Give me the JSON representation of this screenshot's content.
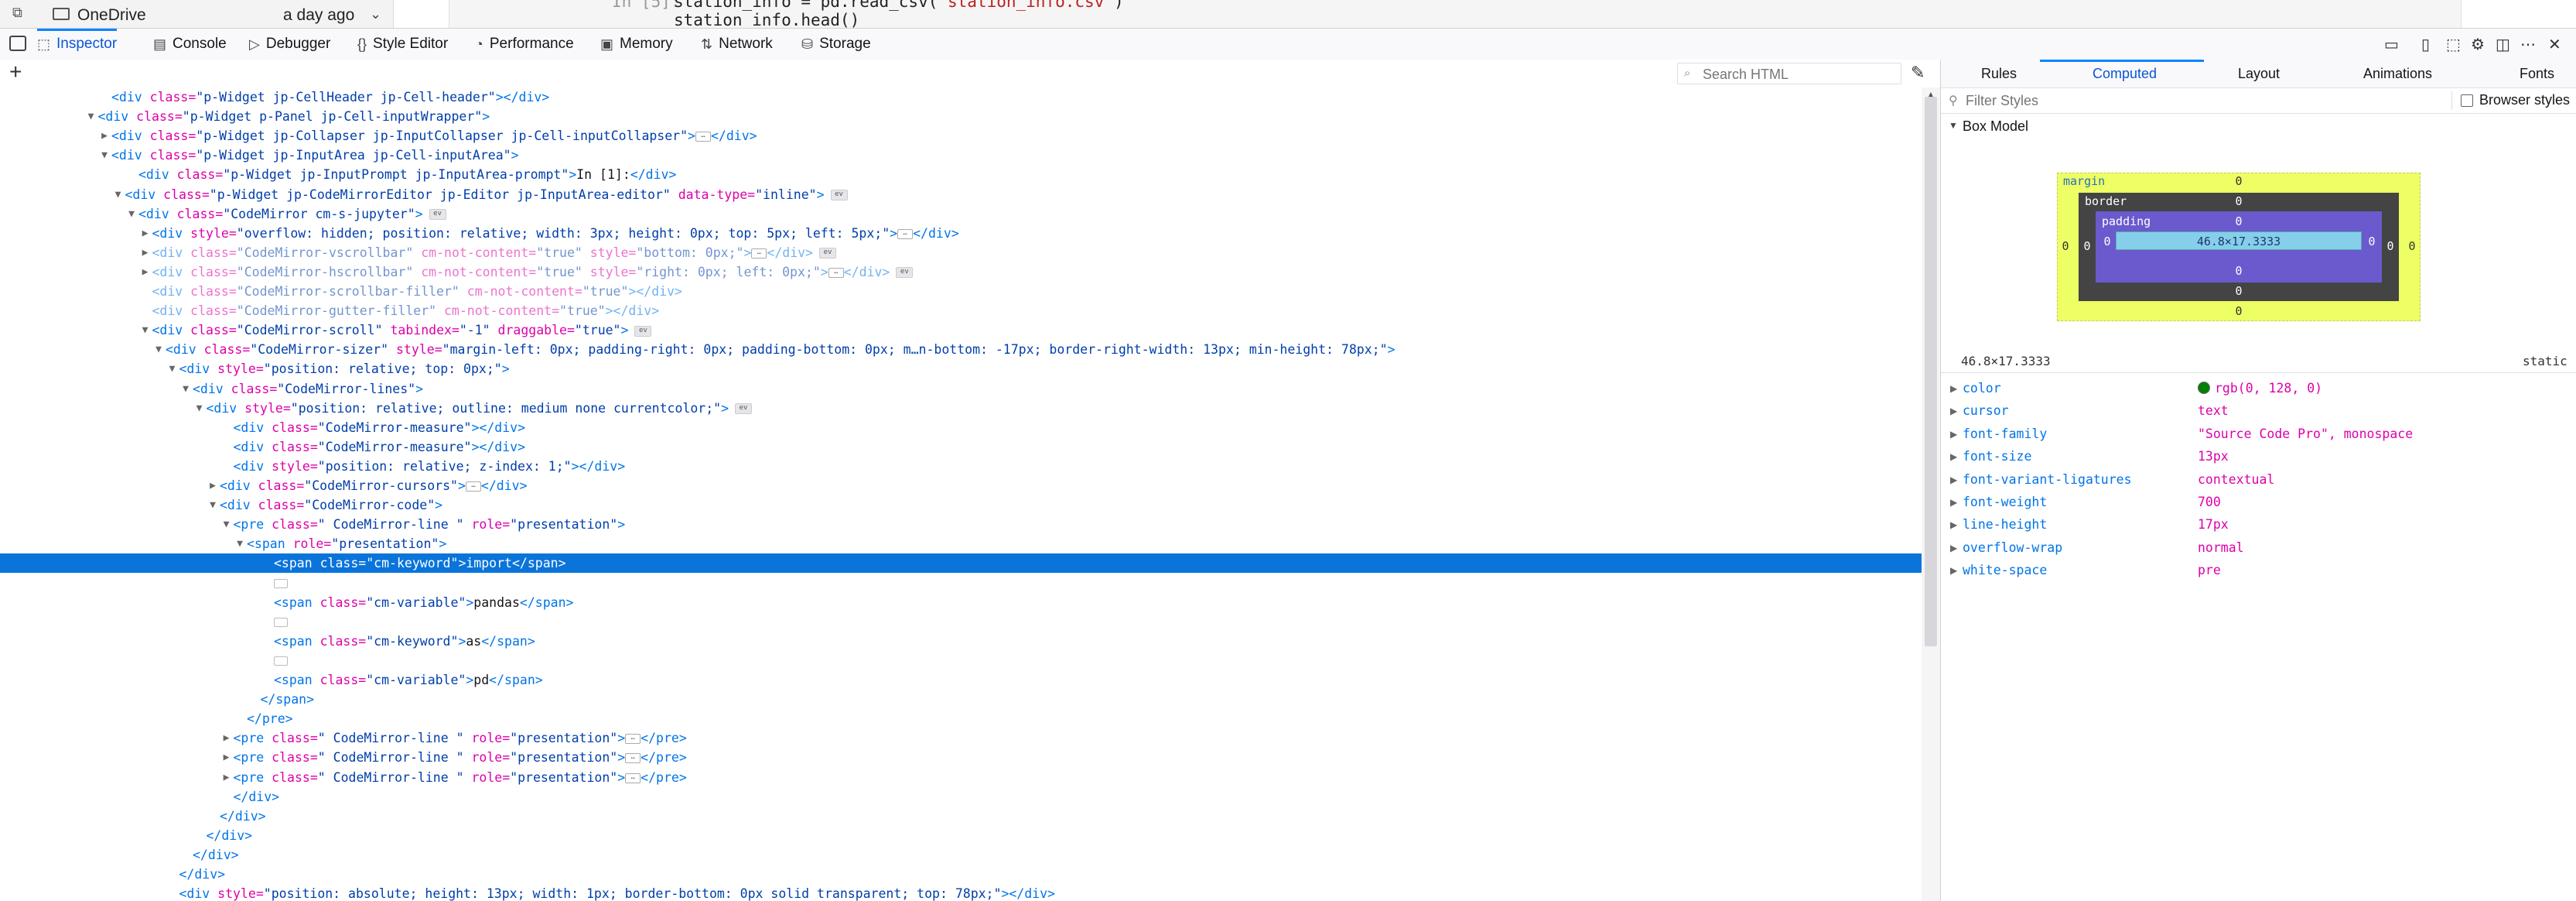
{
  "top_strip": {
    "file_item": "OneDrive",
    "file_modified": "a day ago",
    "prompt": "In [5]:",
    "code_line1_prefix": "station_info = pd.read_csv(",
    "code_line1_string": "'station_info.csv'",
    "code_line1_suffix": ")",
    "code_line2": "station_info.head()"
  },
  "toolbar": {
    "tabs": [
      {
        "label": "Inspector",
        "icon": "inspector-icon",
        "selected": true
      },
      {
        "label": "Console",
        "icon": "console-icon"
      },
      {
        "label": "Debugger",
        "icon": "debugger-icon"
      },
      {
        "label": "Style Editor",
        "icon": "style-editor-icon"
      },
      {
        "label": "Performance",
        "icon": "performance-icon"
      },
      {
        "label": "Memory",
        "icon": "memory-icon"
      },
      {
        "label": "Network",
        "icon": "network-icon"
      },
      {
        "label": "Storage",
        "icon": "storage-icon"
      }
    ]
  },
  "inspector": {
    "search_placeholder": "Search HTML",
    "tree": [
      {
        "depth": 8,
        "segs": [
          [
            "tg",
            "<div "
          ],
          [
            "at",
            "class="
          ],
          [
            "av",
            "\"p-Widget jp-CellHeader jp-Cell-header\""
          ],
          [
            "tg",
            "></div>"
          ]
        ]
      },
      {
        "depth": 7,
        "tw": "open",
        "segs": [
          [
            "tg",
            "<div "
          ],
          [
            "at",
            "class="
          ],
          [
            "av",
            "\"p-Widget p-Panel jp-Cell-inputWrapper\""
          ],
          [
            "tg",
            ">"
          ]
        ]
      },
      {
        "depth": 8,
        "tw": "closed",
        "segs": [
          [
            "tg",
            "<div "
          ],
          [
            "at",
            "class="
          ],
          [
            "av",
            "\"p-Widget jp-Collapser jp-InputCollapser jp-Cell-inputCollapser\""
          ],
          [
            "tg",
            ">"
          ],
          [
            "ell",
            ""
          ],
          [
            "tg",
            "</div>"
          ]
        ]
      },
      {
        "depth": 8,
        "tw": "open",
        "segs": [
          [
            "tg",
            "<div "
          ],
          [
            "at",
            "class="
          ],
          [
            "av",
            "\"p-Widget jp-InputArea jp-Cell-inputArea\""
          ],
          [
            "tg",
            ">"
          ]
        ]
      },
      {
        "depth": 10,
        "segs": [
          [
            "tg",
            "<div "
          ],
          [
            "at",
            "class="
          ],
          [
            "av",
            "\"p-Widget jp-InputPrompt jp-InputArea-prompt\""
          ],
          [
            "tg",
            ">"
          ],
          [
            "pl",
            "In [1]:"
          ],
          [
            "tg",
            "</div>"
          ]
        ]
      },
      {
        "depth": 9,
        "tw": "open",
        "segs": [
          [
            "tg",
            "<div "
          ],
          [
            "at",
            "class="
          ],
          [
            "av",
            "\"p-Widget jp-CodeMirrorEditor jp-Editor jp-InputArea-editor\" "
          ],
          [
            "at",
            "data-type="
          ],
          [
            "av",
            "\"inline\""
          ],
          [
            "tg",
            ">"
          ],
          [
            "badge",
            "ev"
          ]
        ]
      },
      {
        "depth": 10,
        "tw": "open",
        "segs": [
          [
            "tg",
            "<div "
          ],
          [
            "at",
            "class="
          ],
          [
            "av",
            "\"CodeMirror cm-s-jupyter\""
          ],
          [
            "tg",
            ">"
          ],
          [
            "badge",
            "ev"
          ]
        ]
      },
      {
        "depth": 11,
        "tw": "closed",
        "segs": [
          [
            "tg",
            "<div "
          ],
          [
            "at",
            "style="
          ],
          [
            "av",
            "\"overflow: hidden; position: relative; width: 3px; height: 0px; top: 5px; left: 5px;\""
          ],
          [
            "tg",
            ">"
          ],
          [
            "ell",
            ""
          ],
          [
            "tg",
            "</div>"
          ]
        ]
      },
      {
        "depth": 11,
        "tw": "closed",
        "dim": true,
        "segs": [
          [
            "tg",
            "<div "
          ],
          [
            "at",
            "class="
          ],
          [
            "av",
            "\"CodeMirror-vscrollbar\" "
          ],
          [
            "at",
            "cm-not-content="
          ],
          [
            "av",
            "\"true\" "
          ],
          [
            "at",
            "style="
          ],
          [
            "av",
            "\"bottom: 0px;\""
          ],
          [
            "tg",
            ">"
          ],
          [
            "ell",
            ""
          ],
          [
            "tg",
            "</div>"
          ],
          [
            "badge",
            "ev"
          ]
        ]
      },
      {
        "depth": 11,
        "tw": "closed",
        "dim": true,
        "segs": [
          [
            "tg",
            "<div "
          ],
          [
            "at",
            "class="
          ],
          [
            "av",
            "\"CodeMirror-hscrollbar\" "
          ],
          [
            "at",
            "cm-not-content="
          ],
          [
            "av",
            "\"true\" "
          ],
          [
            "at",
            "style="
          ],
          [
            "av",
            "\"right: 0px; left: 0px;\""
          ],
          [
            "tg",
            ">"
          ],
          [
            "ell",
            ""
          ],
          [
            "tg",
            "</div>"
          ],
          [
            "badge",
            "ev"
          ]
        ]
      },
      {
        "depth": 11,
        "dim": true,
        "segs": [
          [
            "tg",
            "<div "
          ],
          [
            "at",
            "class="
          ],
          [
            "av",
            "\"CodeMirror-scrollbar-filler\" "
          ],
          [
            "at",
            "cm-not-content="
          ],
          [
            "av",
            "\"true\""
          ],
          [
            "tg",
            "></div>"
          ]
        ]
      },
      {
        "depth": 11,
        "dim": true,
        "segs": [
          [
            "tg",
            "<div "
          ],
          [
            "at",
            "class="
          ],
          [
            "av",
            "\"CodeMirror-gutter-filler\" "
          ],
          [
            "at",
            "cm-not-content="
          ],
          [
            "av",
            "\"true\""
          ],
          [
            "tg",
            "></div>"
          ]
        ]
      },
      {
        "depth": 11,
        "tw": "open",
        "segs": [
          [
            "tg",
            "<div "
          ],
          [
            "at",
            "class="
          ],
          [
            "av",
            "\"CodeMirror-scroll\" "
          ],
          [
            "at",
            "tabindex="
          ],
          [
            "av",
            "\"-1\" "
          ],
          [
            "at",
            "draggable="
          ],
          [
            "av",
            "\"true\""
          ],
          [
            "tg",
            ">"
          ],
          [
            "badge",
            "ev"
          ]
        ]
      },
      {
        "depth": 12,
        "tw": "open",
        "segs": [
          [
            "tg",
            "<div "
          ],
          [
            "at",
            "class="
          ],
          [
            "av",
            "\"CodeMirror-sizer\" "
          ],
          [
            "at",
            "style="
          ],
          [
            "av",
            "\"margin-left: 0px; padding-right: 0px; padding-bottom: 0px; m…n-bottom: -17px; border-right-width: 13px; min-height: 78px;\""
          ],
          [
            "tg",
            ">"
          ]
        ]
      },
      {
        "depth": 13,
        "tw": "open",
        "segs": [
          [
            "tg",
            "<div "
          ],
          [
            "at",
            "style="
          ],
          [
            "av",
            "\"position: relative; top: 0px;\""
          ],
          [
            "tg",
            ">"
          ]
        ]
      },
      {
        "depth": 14,
        "tw": "open",
        "segs": [
          [
            "tg",
            "<div "
          ],
          [
            "at",
            "class="
          ],
          [
            "av",
            "\"CodeMirror-lines\""
          ],
          [
            "tg",
            ">"
          ]
        ]
      },
      {
        "depth": 15,
        "tw": "open",
        "segs": [
          [
            "tg",
            "<div "
          ],
          [
            "at",
            "style="
          ],
          [
            "av",
            "\"position: relative; outline: medium none currentcolor;\""
          ],
          [
            "tg",
            ">"
          ],
          [
            "badge",
            "ev"
          ]
        ]
      },
      {
        "depth": 17,
        "segs": [
          [
            "tg",
            "<div "
          ],
          [
            "at",
            "class="
          ],
          [
            "av",
            "\"CodeMirror-measure\""
          ],
          [
            "tg",
            "></div>"
          ]
        ]
      },
      {
        "depth": 17,
        "segs": [
          [
            "tg",
            "<div "
          ],
          [
            "at",
            "class="
          ],
          [
            "av",
            "\"CodeMirror-measure\""
          ],
          [
            "tg",
            "></div>"
          ]
        ]
      },
      {
        "depth": 17,
        "segs": [
          [
            "tg",
            "<div "
          ],
          [
            "at",
            "style="
          ],
          [
            "av",
            "\"position: relative; z-index: 1;\""
          ],
          [
            "tg",
            "></div>"
          ]
        ]
      },
      {
        "depth": 16,
        "tw": "closed",
        "segs": [
          [
            "tg",
            "<div "
          ],
          [
            "at",
            "class="
          ],
          [
            "av",
            "\"CodeMirror-cursors\""
          ],
          [
            "tg",
            ">"
          ],
          [
            "ell",
            ""
          ],
          [
            "tg",
            "</div>"
          ]
        ]
      },
      {
        "depth": 16,
        "tw": "open",
        "segs": [
          [
            "tg",
            "<div "
          ],
          [
            "at",
            "class="
          ],
          [
            "av",
            "\"CodeMirror-code\""
          ],
          [
            "tg",
            ">"
          ]
        ]
      },
      {
        "depth": 17,
        "tw": "open",
        "segs": [
          [
            "tg",
            "<pre "
          ],
          [
            "at",
            "class="
          ],
          [
            "av",
            "\" CodeMirror-line \" "
          ],
          [
            "at",
            "role="
          ],
          [
            "av",
            "\"presentation\""
          ],
          [
            "tg",
            ">"
          ]
        ]
      },
      {
        "depth": 18,
        "tw": "open",
        "segs": [
          [
            "tg",
            "<span "
          ],
          [
            "at",
            "role="
          ],
          [
            "av",
            "\"presentation\""
          ],
          [
            "tg",
            ">"
          ]
        ]
      },
      {
        "depth": 20,
        "selected": true,
        "segs": [
          [
            "tg",
            "<span "
          ],
          [
            "at",
            "class="
          ],
          [
            "av",
            "\"cm-keyword\""
          ],
          [
            "tg",
            ">"
          ],
          [
            "pl",
            "import"
          ],
          [
            "tg",
            "</span>"
          ]
        ]
      },
      {
        "depth": 20,
        "segs": [
          [
            "ws",
            ""
          ]
        ]
      },
      {
        "depth": 20,
        "segs": [
          [
            "tg",
            "<span "
          ],
          [
            "at",
            "class="
          ],
          [
            "av",
            "\"cm-variable\""
          ],
          [
            "tg",
            ">"
          ],
          [
            "pl",
            "pandas"
          ],
          [
            "tg",
            "</span>"
          ]
        ]
      },
      {
        "depth": 20,
        "segs": [
          [
            "ws",
            ""
          ]
        ]
      },
      {
        "depth": 20,
        "segs": [
          [
            "tg",
            "<span "
          ],
          [
            "at",
            "class="
          ],
          [
            "av",
            "\"cm-keyword\""
          ],
          [
            "tg",
            ">"
          ],
          [
            "pl",
            "as"
          ],
          [
            "tg",
            "</span>"
          ]
        ]
      },
      {
        "depth": 20,
        "segs": [
          [
            "ws",
            ""
          ]
        ]
      },
      {
        "depth": 20,
        "segs": [
          [
            "tg",
            "<span "
          ],
          [
            "at",
            "class="
          ],
          [
            "av",
            "\"cm-variable\""
          ],
          [
            "tg",
            ">"
          ],
          [
            "pl",
            "pd"
          ],
          [
            "tg",
            "</span>"
          ]
        ]
      },
      {
        "depth": 19,
        "segs": [
          [
            "tg",
            "</span>"
          ]
        ]
      },
      {
        "depth": 18,
        "segs": [
          [
            "tg",
            "</pre>"
          ]
        ]
      },
      {
        "depth": 17,
        "tw": "closed",
        "segs": [
          [
            "tg",
            "<pre "
          ],
          [
            "at",
            "class="
          ],
          [
            "av",
            "\" CodeMirror-line \" "
          ],
          [
            "at",
            "role="
          ],
          [
            "av",
            "\"presentation\""
          ],
          [
            "tg",
            ">"
          ],
          [
            "ell",
            ""
          ],
          [
            "tg",
            "</pre>"
          ]
        ]
      },
      {
        "depth": 17,
        "tw": "closed",
        "segs": [
          [
            "tg",
            "<pre "
          ],
          [
            "at",
            "class="
          ],
          [
            "av",
            "\" CodeMirror-line \" "
          ],
          [
            "at",
            "role="
          ],
          [
            "av",
            "\"presentation\""
          ],
          [
            "tg",
            ">"
          ],
          [
            "ell",
            ""
          ],
          [
            "tg",
            "</pre>"
          ]
        ]
      },
      {
        "depth": 17,
        "tw": "closed",
        "segs": [
          [
            "tg",
            "<pre "
          ],
          [
            "at",
            "class="
          ],
          [
            "av",
            "\" CodeMirror-line \" "
          ],
          [
            "at",
            "role="
          ],
          [
            "av",
            "\"presentation\""
          ],
          [
            "tg",
            ">"
          ],
          [
            "ell",
            ""
          ],
          [
            "tg",
            "</pre>"
          ]
        ]
      },
      {
        "depth": 17,
        "segs": [
          [
            "tg",
            "</div>"
          ]
        ]
      },
      {
        "depth": 16,
        "segs": [
          [
            "tg",
            "</div>"
          ]
        ]
      },
      {
        "depth": 15,
        "segs": [
          [
            "tg",
            "</div>"
          ]
        ]
      },
      {
        "depth": 14,
        "segs": [
          [
            "tg",
            "</div>"
          ]
        ]
      },
      {
        "depth": 13,
        "segs": [
          [
            "tg",
            "</div>"
          ]
        ]
      },
      {
        "depth": 13,
        "segs": [
          [
            "tg",
            "<div "
          ],
          [
            "at",
            "style="
          ],
          [
            "av",
            "\"position: absolute; height: 13px; width: 1px; border-bottom: 0px solid transparent; top: 78px;\""
          ],
          [
            "tg",
            "></div>"
          ]
        ]
      }
    ]
  },
  "sidebar": {
    "tabs": [
      "Rules",
      "Computed",
      "Layout",
      "Animations",
      "Fonts"
    ],
    "selected_tab": "Computed",
    "filter_placeholder": "Filter Styles",
    "browser_styles_label": "Browser styles",
    "browser_styles_checked": false,
    "box_model_title": "Box Model",
    "box_model": {
      "margin_label": "margin",
      "border_label": "border",
      "padding_label": "padding",
      "margin": {
        "top": "0",
        "right": "0",
        "bottom": "0",
        "left": "0"
      },
      "border": {
        "top": "0",
        "right": "0",
        "bottom": "0",
        "left": "0"
      },
      "padding": {
        "top": "0",
        "right": "0",
        "bottom": "0",
        "left": "0"
      },
      "content": "46.8×17.3333"
    },
    "dimensions": "46.8×17.3333",
    "position": "static",
    "properties": [
      {
        "name": "color",
        "value": "rgb(0, 128, 0)",
        "swatch": "#008000"
      },
      {
        "name": "cursor",
        "value": "text"
      },
      {
        "name": "font-family",
        "value": "\"Source Code Pro\", monospace"
      },
      {
        "name": "font-size",
        "value": "13px"
      },
      {
        "name": "font-variant-ligatures",
        "value": "contextual"
      },
      {
        "name": "font-weight",
        "value": "700"
      },
      {
        "name": "line-height",
        "value": "17px"
      },
      {
        "name": "overflow-wrap",
        "value": "normal"
      },
      {
        "name": "white-space",
        "value": "pre"
      }
    ]
  }
}
